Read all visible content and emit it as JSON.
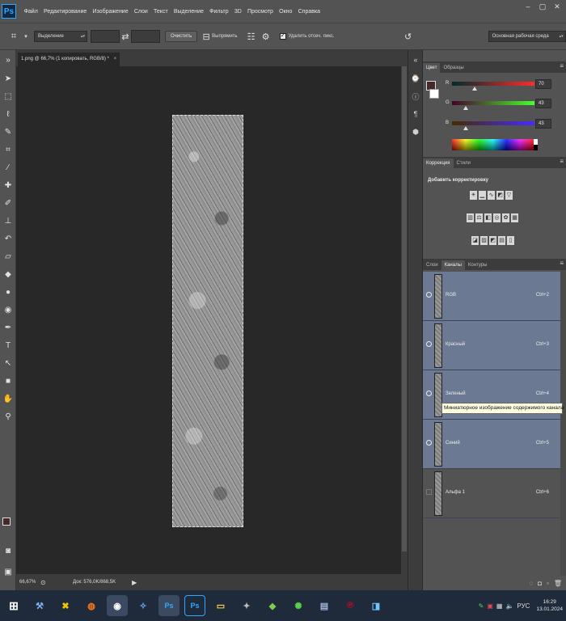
{
  "app": {
    "logo": "Ps"
  },
  "menu": [
    "Файл",
    "Редактирование",
    "Изображение",
    "Слои",
    "Текст",
    "Выделение",
    "Фильтр",
    "3D",
    "Просмотр",
    "Окно",
    "Справка"
  ],
  "window_controls": {
    "minimize": "–",
    "restore": "▢",
    "close": "✕"
  },
  "options": {
    "style_select": "Выделение",
    "clear_button": "Очистить",
    "straighten_label": "Выпрямить",
    "delete_crop_label": "Удалить отсеч. пикс.",
    "workspace": "Основная рабочая среда"
  },
  "document": {
    "tab_title": "1.png @ 66,7% (1 копировать, RGB/8) *",
    "close": "×"
  },
  "status": {
    "zoom": "66,67%",
    "doc": "Док: 576,0K/868,5K"
  },
  "color_panel": {
    "tabs": [
      "Цвет",
      "Образцы"
    ],
    "r": {
      "label": "R",
      "value": "70",
      "fraction": 0.27
    },
    "g": {
      "label": "G",
      "value": "43",
      "fraction": 0.17
    },
    "b": {
      "label": "B",
      "value": "43",
      "fraction": 0.17
    },
    "foreground": "#46282b"
  },
  "adjustments": {
    "tabs": [
      "Коррекция",
      "Стили"
    ],
    "title": "Добавить корректировку"
  },
  "layers_panel": {
    "tabs": [
      "Слои",
      "Каналы",
      "Контуры"
    ],
    "channels": [
      {
        "name": "RGB",
        "key": "Ctrl+2",
        "visible": true
      },
      {
        "name": "Красный",
        "key": "Ctrl+3",
        "visible": true
      },
      {
        "name": "Зеленый",
        "key": "Ctrl+4",
        "visible": true
      },
      {
        "name": "Синий",
        "key": "Ctrl+5",
        "visible": true
      },
      {
        "name": "Альфа 1",
        "key": "Ctrl+6",
        "visible": false
      }
    ],
    "tooltip": "Миниатюрное изображение содержимого канала"
  },
  "taskbar": {
    "lang": "РУС",
    "time": "16:29",
    "date": "13.01.2024"
  }
}
